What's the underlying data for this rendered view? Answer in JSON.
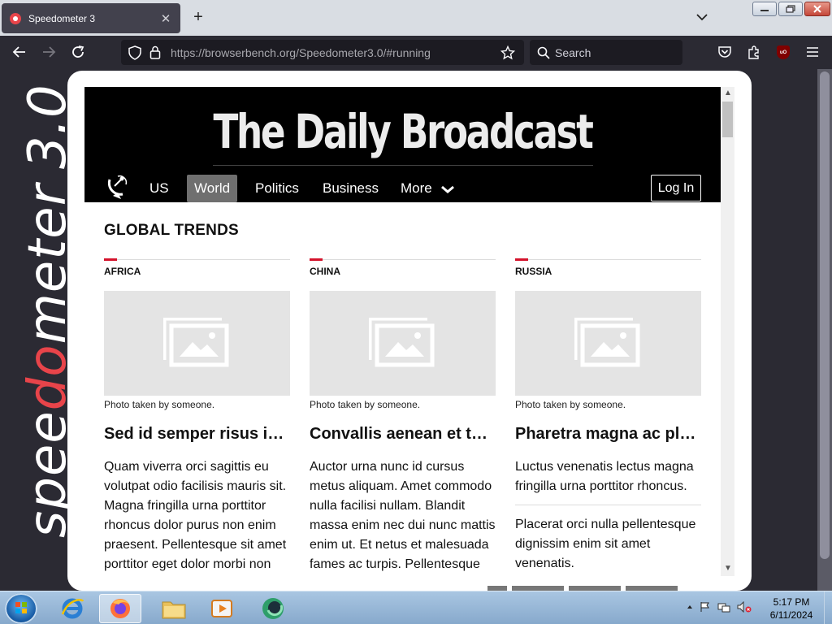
{
  "browser": {
    "tab_title": "Speedometer 3",
    "tab_close": "✕",
    "new_tab": "+",
    "url_domain": "https://browserbench.org",
    "url_path": "/Speedometer3.0/#running",
    "search_placeholder": "Search",
    "ublock_badge": "uO"
  },
  "logo": {
    "text_pre": "spee",
    "text_accent": "d",
    "text_accent2": "o",
    "text_post": "meter",
    "version": "3.0"
  },
  "site": {
    "brand": "The Daily Broadcast",
    "nav": [
      {
        "label": "US"
      },
      {
        "label": "World",
        "active": true
      },
      {
        "label": "Politics"
      },
      {
        "label": "Business"
      },
      {
        "label": "More"
      }
    ],
    "login_label": "Log In",
    "section_title": "GLOBAL TRENDS",
    "columns": [
      {
        "label": "AFRICA",
        "caption": "Photo taken by someone.",
        "headline": "Sed id semper risus in hendrerit",
        "body": "Quam viverra orci sagittis eu volutpat odio facilisis mauris sit. Magna fringilla urna porttitor rhoncus dolor purus non enim praesent. Pellentesque sit amet porttitor eget dolor morbi non"
      },
      {
        "label": "CHINA",
        "caption": "Photo taken by someone.",
        "headline": "Convallis aenean et tortor at",
        "body": "Auctor urna nunc id cursus metus aliquam. Amet commodo nulla facilisi nullam. Blandit massa enim nec dui nunc mattis enim ut. Et netus et malesuada fames ac turpis. Pellentesque"
      },
      {
        "label": "RUSSIA",
        "caption": "Photo taken by someone.",
        "headline": "Pharetra magna ac placerat vestibulum",
        "body": "Luctus venenatis lectus magna fringilla urna porttitor rhoncus.",
        "body2": "Placerat orci nulla pellentesque dignissim enim sit amet venenatis."
      }
    ]
  },
  "taskbar": {
    "time": "5:17 PM",
    "date": "6/11/2024"
  },
  "colors": {
    "accent_red": "#d4122b",
    "brand_bg": "#000000",
    "speedometer_red": "#e8444a"
  }
}
